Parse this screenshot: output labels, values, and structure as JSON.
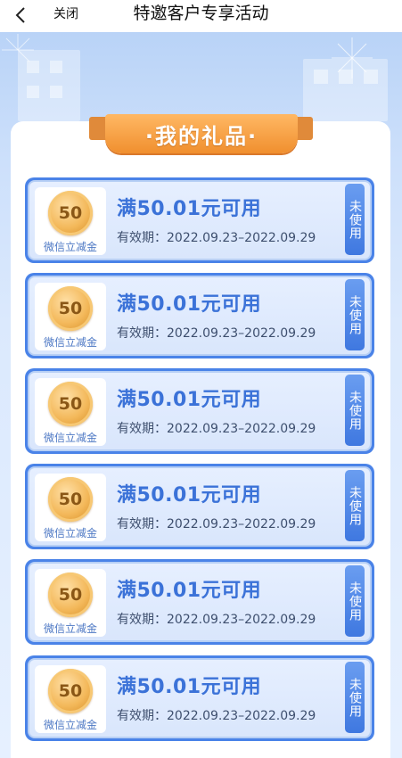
{
  "navbar": {
    "back_icon": "chevron-left-icon",
    "close_label": "关闭",
    "title": "特邀客户专享活动"
  },
  "panel": {
    "ribbon_title": "·我的礼品·"
  },
  "coupons": [
    {
      "coin_value": "50",
      "sub_label": "微信立减金",
      "title": "满50.01元可用",
      "validity": "有效期：2022.09.23–2022.09.29",
      "status": "未使用"
    },
    {
      "coin_value": "50",
      "sub_label": "微信立减金",
      "title": "满50.01元可用",
      "validity": "有效期：2022.09.23–2022.09.29",
      "status": "未使用"
    },
    {
      "coin_value": "50",
      "sub_label": "微信立减金",
      "title": "满50.01元可用",
      "validity": "有效期：2022.09.23–2022.09.29",
      "status": "未使用"
    },
    {
      "coin_value": "50",
      "sub_label": "微信立减金",
      "title": "满50.01元可用",
      "validity": "有效期：2022.09.23–2022.09.29",
      "status": "未使用"
    },
    {
      "coin_value": "50",
      "sub_label": "微信立减金",
      "title": "满50.01元可用",
      "validity": "有效期：2022.09.23–2022.09.29",
      "status": "未使用"
    },
    {
      "coin_value": "50",
      "sub_label": "微信立减金",
      "title": "满50.01元可用",
      "validity": "有效期：2022.09.23–2022.09.29",
      "status": "未使用"
    }
  ],
  "colors": {
    "accent_blue": "#3b72d8",
    "ribbon_orange": "#f08f2e",
    "coin_gold": "#f3b85a"
  }
}
